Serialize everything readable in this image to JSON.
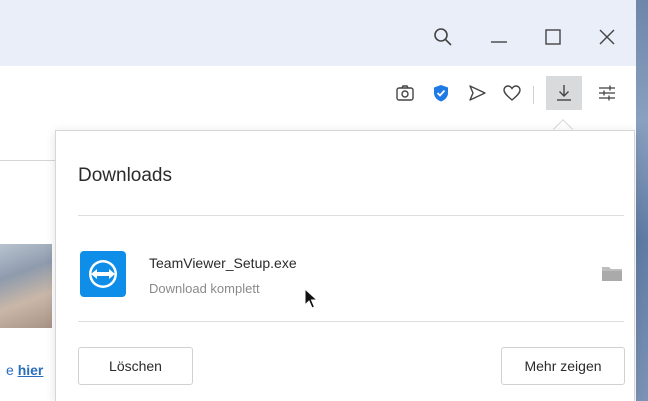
{
  "page": {
    "link_prefix": "e",
    "link_text": "hier"
  },
  "toolbar_icons": [
    "camera-icon",
    "shield-icon",
    "send-icon",
    "heart-icon",
    "download-icon",
    "settings-sliders-icon"
  ],
  "downloads": {
    "title": "Downloads",
    "items": [
      {
        "name": "TeamViewer_Setup.exe",
        "status": "Download komplett",
        "icon": "teamviewer-icon"
      }
    ],
    "clear_label": "Löschen",
    "more_label": "Mehr zeigen"
  },
  "colors": {
    "accent": "#0e8ee9",
    "shield": "#1e7be6",
    "link": "#2a6ebd"
  }
}
